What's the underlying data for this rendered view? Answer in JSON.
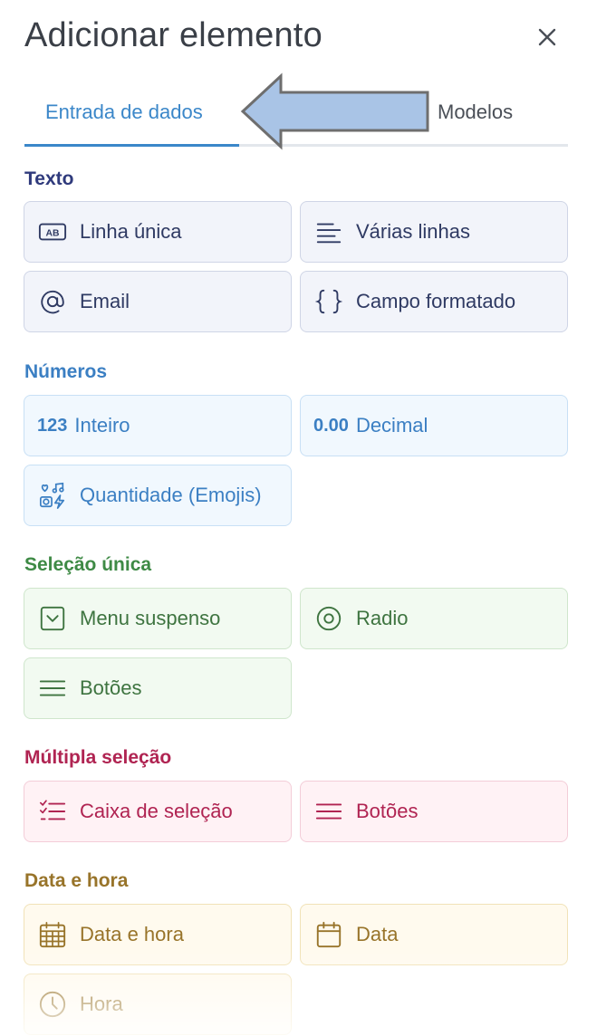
{
  "header": {
    "title": "Adicionar elemento"
  },
  "tabs": [
    {
      "label": "Entrada de dados",
      "active": true
    },
    {
      "label": "Modelos",
      "active": false
    }
  ],
  "colors": {
    "accent": "#3b87c9",
    "text_section": "#2f3a7c",
    "numbers_section": "#3b7fc3",
    "single_section": "#3e8a45",
    "multi_section": "#b02452",
    "date_section": "#98742a"
  },
  "sections": {
    "texto": {
      "title": "Texto",
      "items": [
        {
          "label": "Linha única",
          "icon": "ab-text-icon"
        },
        {
          "label": "Várias linhas",
          "icon": "multiline-icon"
        },
        {
          "label": "Email",
          "icon": "at-sign-icon"
        },
        {
          "label": "Campo formatado",
          "icon": "braces-icon"
        }
      ]
    },
    "numeros": {
      "title": "Números",
      "items": [
        {
          "tag": "123",
          "label": "Inteiro"
        },
        {
          "tag": "0.00",
          "label": "Decimal"
        },
        {
          "label": "Quantidade (Emojis)",
          "icon": "emoji-quantity-icon"
        }
      ]
    },
    "selecao_unica": {
      "title": "Seleção única",
      "items": [
        {
          "label": "Menu suspenso",
          "icon": "dropdown-icon"
        },
        {
          "label": "Radio",
          "icon": "radio-icon"
        },
        {
          "label": "Botões",
          "icon": "list-lines-icon"
        }
      ]
    },
    "multipla_selecao": {
      "title": "Múltipla seleção",
      "items": [
        {
          "label": "Caixa de seleção",
          "icon": "checklist-icon"
        },
        {
          "label": "Botões",
          "icon": "list-lines-icon"
        }
      ]
    },
    "data_hora": {
      "title": "Data e hora",
      "items": [
        {
          "label": "Data e hora",
          "icon": "calendar-grid-icon"
        },
        {
          "label": "Data",
          "icon": "calendar-icon"
        },
        {
          "label": "Hora",
          "icon": "clock-icon"
        }
      ]
    }
  }
}
